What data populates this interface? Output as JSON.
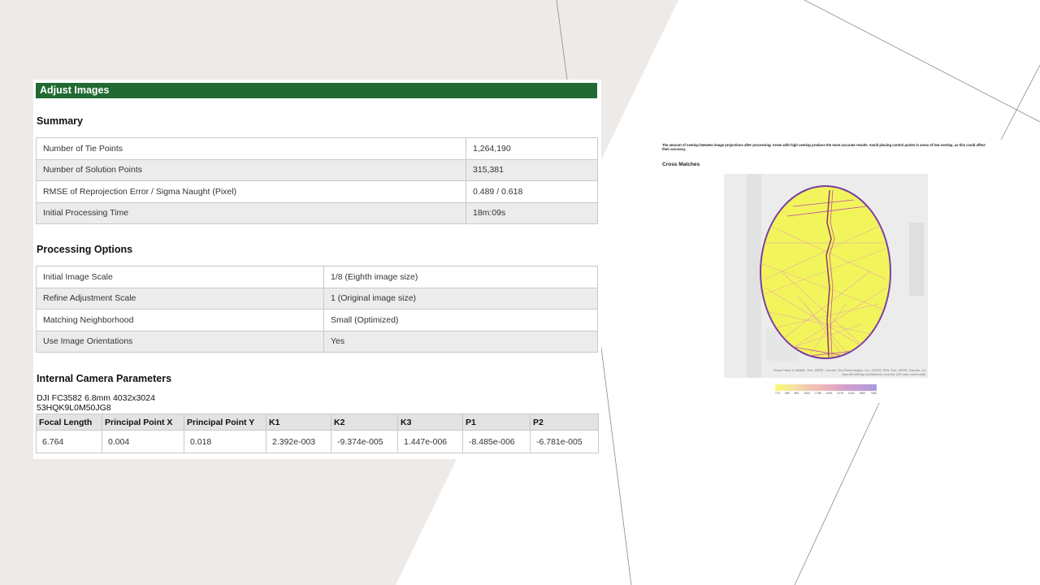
{
  "report": {
    "banner": "Adjust Images",
    "summary": {
      "heading": "Summary",
      "rows": [
        {
          "label": "Number of Tie Points",
          "value": "1,264,190"
        },
        {
          "label": "Number of Solution Points",
          "value": "315,381"
        },
        {
          "label": "RMSE of Reprojection Error / Sigma Naught (Pixel)",
          "value": "0.489 / 0.618"
        },
        {
          "label": "Initial Processing Time",
          "value": "18m:09s"
        }
      ]
    },
    "processing": {
      "heading": "Processing Options",
      "rows": [
        {
          "label": "Initial Image Scale",
          "value": "1/8 (Eighth image size)"
        },
        {
          "label": "Refine Adjustment Scale",
          "value": "1 (Original image size)"
        },
        {
          "label": "Matching Neighborhood",
          "value": "Small (Optimized)"
        },
        {
          "label": "Use Image Orientations",
          "value": "Yes"
        }
      ]
    },
    "camera": {
      "heading": "Internal Camera Parameters",
      "model": "DJI FC3582 6.8mm 4032x3024",
      "serial": "53HQK9L0M50JG8",
      "headers": [
        "Focal Length",
        "Principal Point X",
        "Principal Point Y",
        "K1",
        "K2",
        "K3",
        "P1",
        "P2"
      ],
      "values": [
        "6.764",
        "0.004",
        "0.018",
        "2.392e-003",
        "-9.374e-005",
        "1.447e-006",
        "-8.485e-006",
        "-6.781e-005"
      ]
    }
  },
  "cross_matches": {
    "description": "The amount of overlap between image projections after processing. Areas with high overlap produce the most accurate results. Avoid placing control points in areas of low overlap, as this could affect their accuracy.",
    "title": "Cross Matches",
    "attribution_line1": "Texas Parks & Wildlife, Esri, HERE, Garmin, GeoTechnologies, Inc., USGS, EPA, Esri, HERE, Garmin, (c)",
    "attribution_line2": "OpenStreetMap contributors, and the GIS user community",
    "legend_labels": [
      "174",
      "488",
      "863",
      "1004",
      "1768",
      "2094",
      "3176",
      "1203",
      "3552",
      "7384"
    ],
    "legend_colors": [
      "#fafa6e",
      "#eeb2bc",
      "#a79be0"
    ]
  }
}
